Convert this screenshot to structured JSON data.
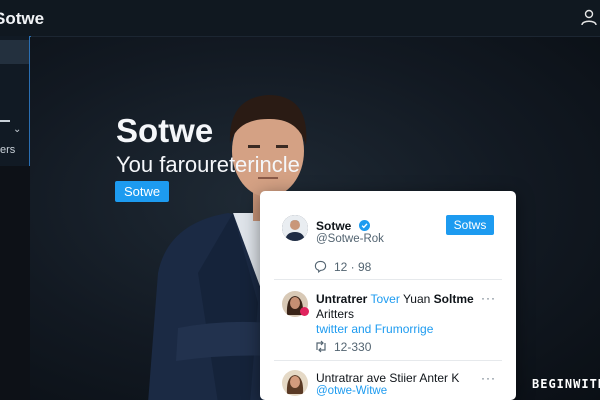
{
  "app": {
    "brand": "Sotwe"
  },
  "sidebar": {
    "items": [
      {
        "label": "ers"
      }
    ]
  },
  "hero": {
    "title": "Sotwe",
    "subtitle": "You faroureterincle",
    "button_label": "Sotwe"
  },
  "feed": {
    "profile": {
      "name": "Sotwe",
      "handle": "@Sotwe-Rok",
      "follow_label": "Sotws",
      "reply_count": "12 · 98"
    },
    "posts": [
      {
        "title_plain": "Untratrer",
        "title_blue": "Tover",
        "title_rest_plain": "Yuan",
        "title_rest_bold": "Soltme",
        "line2": "Aritters",
        "line3": "twitter and Frumorrige",
        "retweet_count": "12-330",
        "more_label": "···"
      },
      {
        "title": "Untratrar ave Stiier Anter K",
        "handle": "@otwe-Witwe",
        "more_label": "···"
      }
    ]
  },
  "watermark": "BEGINWITH",
  "colors": {
    "accent": "#1d9bf0",
    "topbar": "#101820",
    "card": "#ffffff"
  },
  "icons": [
    "user-icon",
    "verified-icon",
    "reply-icon",
    "retweet-icon",
    "more-icon",
    "chevron-down-icon"
  ]
}
